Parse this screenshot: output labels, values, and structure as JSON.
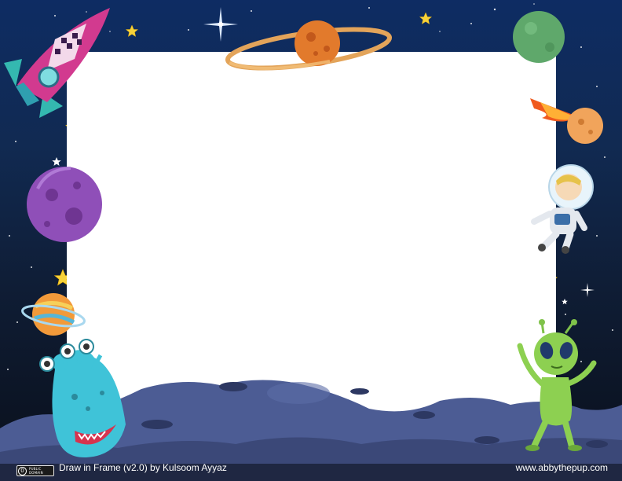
{
  "artwork": {
    "name": "space-themed drawing frame",
    "frame_area": "blank white drawing area",
    "icons": [
      "rocket-icon",
      "ringed-planet-icon",
      "green-planet-icon",
      "comet-icon",
      "purple-planet-icon",
      "astronaut-icon",
      "orange-planet-icon",
      "blue-monster-icon",
      "green-alien-icon",
      "moon-surface"
    ]
  },
  "footer": {
    "badge_top": "PUBLIC",
    "badge_bottom": "DOMAIN",
    "credit": "Draw in Frame (v2.0) by Kulsoom Ayyaz",
    "website": "www.abbythepup.com"
  },
  "colors": {
    "sky_top": "#0e2c63",
    "sky_bottom": "#0a0f1a",
    "frame": "#ffffff",
    "moon_rock": "#4a5b94",
    "footer_text": "#ffffff"
  }
}
